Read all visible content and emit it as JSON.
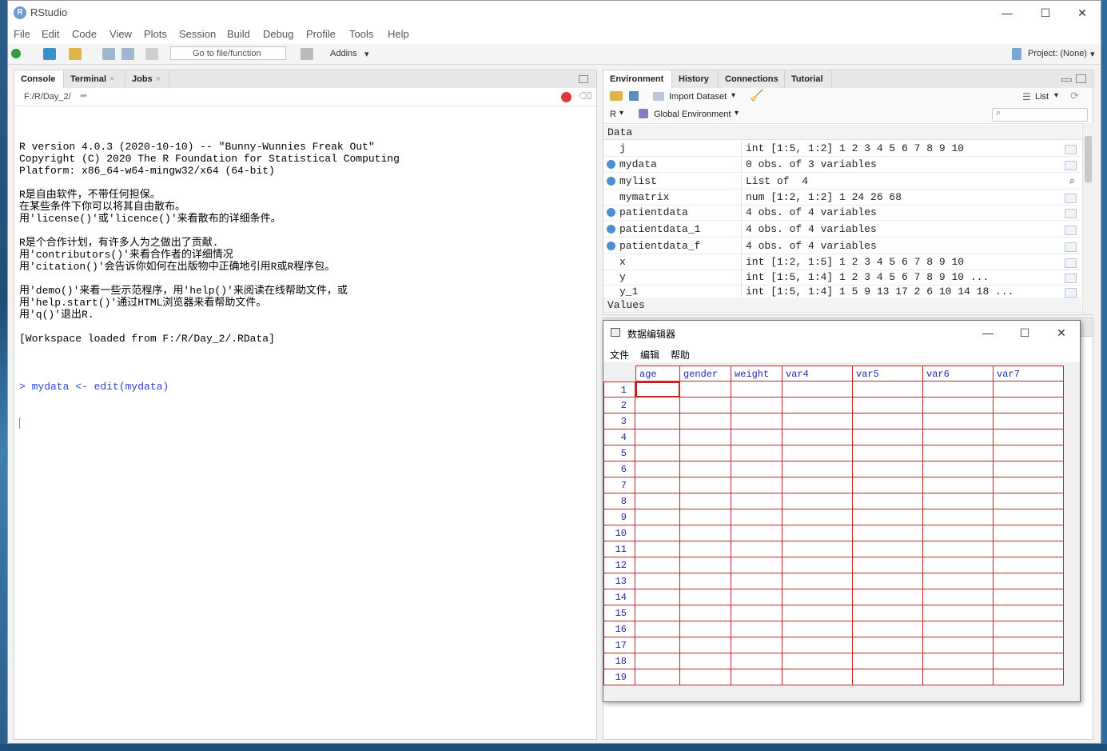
{
  "app": {
    "title": "RStudio",
    "icon_letter": "R"
  },
  "window_controls": {
    "minimize": "—",
    "maximize": "☐",
    "close": "✕"
  },
  "menu": [
    "File",
    "Edit",
    "Code",
    "View",
    "Plots",
    "Session",
    "Build",
    "Debug",
    "Profile",
    "Tools",
    "Help"
  ],
  "toolbar": {
    "goto_placeholder": "Go to file/function",
    "addins": "Addins",
    "project": "Project: (None)"
  },
  "left_pane": {
    "tabs": [
      {
        "label": "Console",
        "closable": false
      },
      {
        "label": "Terminal",
        "closable": true
      },
      {
        "label": "Jobs",
        "closable": true
      }
    ],
    "path": "F:/R/Day_2/",
    "console_lines": [
      "R version 4.0.3 (2020-10-10) -- \"Bunny-Wunnies Freak Out\"",
      "Copyright (C) 2020 The R Foundation for Statistical Computing",
      "Platform: x86_64-w64-mingw32/x64 (64-bit)",
      "",
      "R是自由软件，不带任何担保。",
      "在某些条件下你可以将其自由散布。",
      "用'license()'或'licence()'来看散布的详细条件。",
      "",
      "R是个合作计划，有许多人为之做出了贡献.",
      "用'contributors()'来看合作者的详细情况",
      "用'citation()'会告诉你如何在出版物中正确地引用R或R程序包。",
      "",
      "用'demo()'来看一些示范程序，用'help()'来阅读在线帮助文件，或",
      "用'help.start()'通过HTML浏览器来看帮助文件。",
      "用'q()'退出R.",
      "",
      "[Workspace loaded from F:/R/Day_2/.RData]",
      ""
    ],
    "command": "> mydata <- edit(mydata)"
  },
  "env_pane": {
    "tabs": [
      "Environment",
      "History",
      "Connections",
      "Tutorial"
    ],
    "import_dataset": "Import Dataset",
    "list_view": "List",
    "lang": "R",
    "global_env": "Global Environment",
    "section_data": "Data",
    "section_values": "Values",
    "rows": [
      {
        "name": "j",
        "value": "int [1:5, 1:2] 1 2 3 4 5 6 7 8 9 10",
        "expand": false,
        "icon": "grid"
      },
      {
        "name": "mydata",
        "value": "0 obs. of 3 variables",
        "expand": true,
        "icon": "grid"
      },
      {
        "name": "mylist",
        "value": "List of  4",
        "expand": true,
        "icon": "search"
      },
      {
        "name": "mymatrix",
        "value": "num [1:2, 1:2] 1 24 26 68",
        "expand": false,
        "icon": "grid"
      },
      {
        "name": "patientdata",
        "value": "4 obs. of 4 variables",
        "expand": true,
        "icon": "grid"
      },
      {
        "name": "patientdata_1",
        "value": "4 obs. of 4 variables",
        "expand": true,
        "icon": "grid"
      },
      {
        "name": "patientdata_f",
        "value": "4 obs. of 4 variables",
        "expand": true,
        "icon": "grid"
      },
      {
        "name": "x",
        "value": "int [1:2, 1:5] 1 2 3 4 5 6 7 8 9 10",
        "expand": false,
        "icon": "grid"
      },
      {
        "name": "y",
        "value": "int [1:5, 1:4] 1 2 3 4 5 6 7 8 9 10 ...",
        "expand": false,
        "icon": "grid"
      },
      {
        "name": "y_1",
        "value": "int [1:5, 1:4] 1 5 9 13 17 2 6 10 14 18 ...",
        "expand": false,
        "icon": "grid"
      }
    ]
  },
  "data_editor": {
    "title": "数据编辑器",
    "menu": [
      "文件",
      "编辑",
      "帮助"
    ],
    "columns": [
      "age",
      "gender",
      "weight",
      "var4",
      "var5",
      "var6",
      "var7"
    ],
    "rows": [
      "1",
      "2",
      "3",
      "4",
      "5",
      "6",
      "7",
      "8",
      "9",
      "10",
      "11",
      "12",
      "13",
      "14",
      "15",
      "16",
      "17",
      "18",
      "19"
    ],
    "selected_cell": {
      "row": 1,
      "col": "age"
    }
  },
  "colors": {
    "accent": "#3344cc",
    "grid_border": "#cc2222",
    "header_text": "#1a2ea8"
  }
}
